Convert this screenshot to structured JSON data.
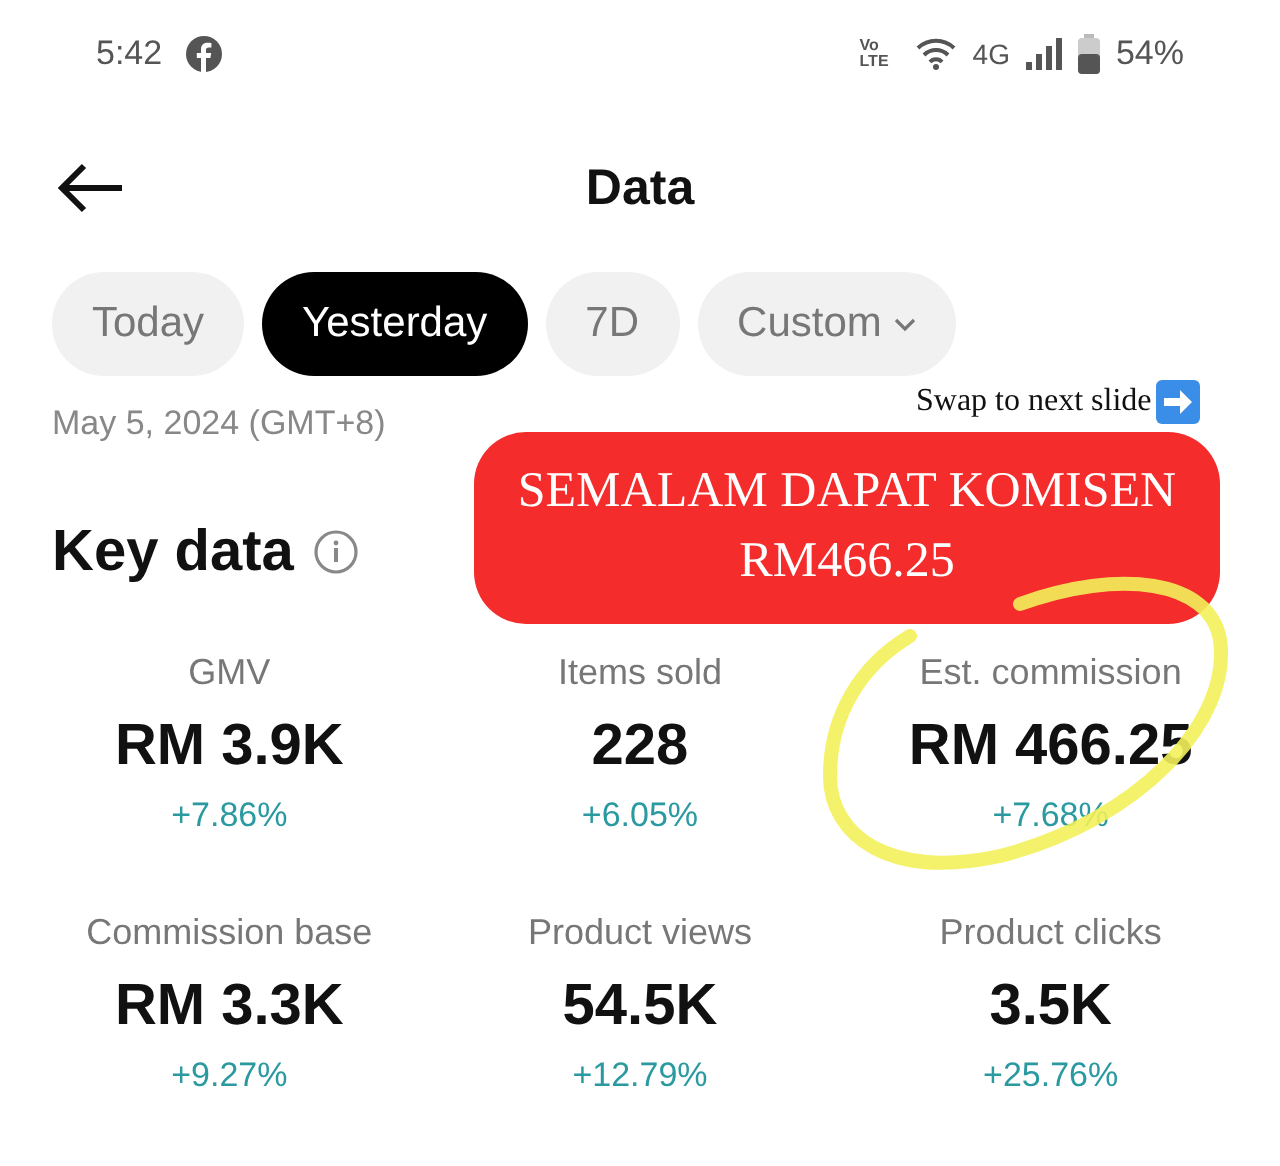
{
  "status_bar": {
    "time": "5:42",
    "volte": [
      "Vo",
      "LTE"
    ],
    "network": "4G",
    "battery": "54%"
  },
  "header": {
    "title": "Data"
  },
  "tabs": [
    {
      "label": "Today",
      "selected": false,
      "dropdown": false
    },
    {
      "label": "Yesterday",
      "selected": true,
      "dropdown": false
    },
    {
      "label": "7D",
      "selected": false,
      "dropdown": false
    },
    {
      "label": "Custom",
      "selected": false,
      "dropdown": true
    }
  ],
  "date": "May 5, 2024 (GMT+8)",
  "section_title": "Key data",
  "metrics": [
    {
      "label": "GMV",
      "value": "RM 3.9K",
      "change": "+7.86%"
    },
    {
      "label": "Items sold",
      "value": "228",
      "change": "+6.05%"
    },
    {
      "label": "Est. commission",
      "value": "RM 466.25",
      "change": "+7.68%"
    },
    {
      "label": "Commission base",
      "value": "RM 3.3K",
      "change": "+9.27%"
    },
    {
      "label": "Product views",
      "value": "54.5K",
      "change": "+12.79%"
    },
    {
      "label": "Product clicks",
      "value": "3.5K",
      "change": "+25.76%"
    }
  ],
  "overlay": {
    "caption": "Swap to next slide",
    "banner": "SEMALAM DAPAT KOMISEN RM466.25"
  }
}
